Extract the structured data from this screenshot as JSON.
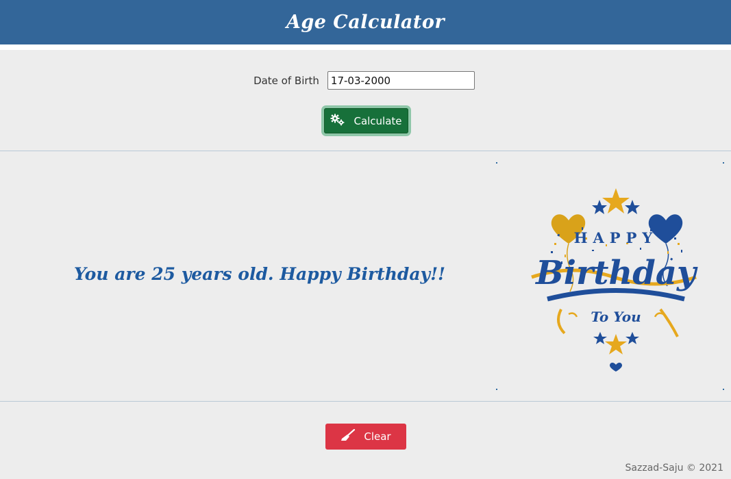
{
  "header": {
    "title": "Age Calculator"
  },
  "form": {
    "dob_label": "Date of Birth",
    "dob_value": "17-03-2000",
    "calculate_label": "Calculate"
  },
  "result": {
    "message": "You are 25 years old. Happy Birthday!!"
  },
  "card": {
    "top_text": "HAPPY",
    "main_text": "Birthday",
    "bottom_text": "To You"
  },
  "actions": {
    "clear_label": "Clear"
  },
  "footer": {
    "credit": "Sazzad-Saju © 2021"
  },
  "icons": {
    "calculate": "gears-icon",
    "clear": "broom-icon"
  },
  "colors": {
    "header_bg": "#336699",
    "calculate_bg": "#17703a",
    "clear_bg": "#dc3545",
    "result_text": "#1d5aa0",
    "card_blue": "#1f4e9a",
    "card_gold": "#e6a81e"
  }
}
